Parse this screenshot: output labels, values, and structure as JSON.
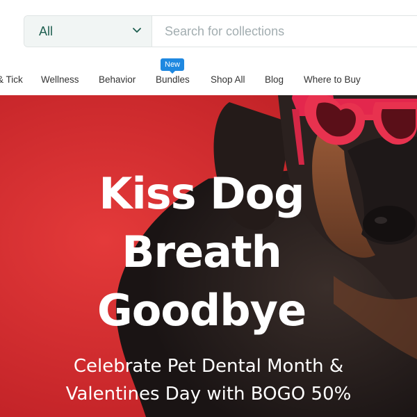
{
  "search": {
    "category_selected": "All",
    "placeholder": "Search for collections"
  },
  "nav": {
    "items": [
      "& Tick",
      "Wellness",
      "Behavior",
      "Bundles",
      "Shop All",
      "Blog",
      "Where to Buy"
    ],
    "badge": "New"
  },
  "hero": {
    "title_lines": [
      "Kiss Dog",
      "Breath",
      "Goodbye"
    ],
    "subtitle_lines": [
      "Celebrate Pet Dental Month &",
      "Valentines Day with BOGO 50%"
    ]
  },
  "colors": {
    "hero_background": "#d9292c",
    "badge": "#1f88e0",
    "select_text": "#1d5e4f"
  }
}
